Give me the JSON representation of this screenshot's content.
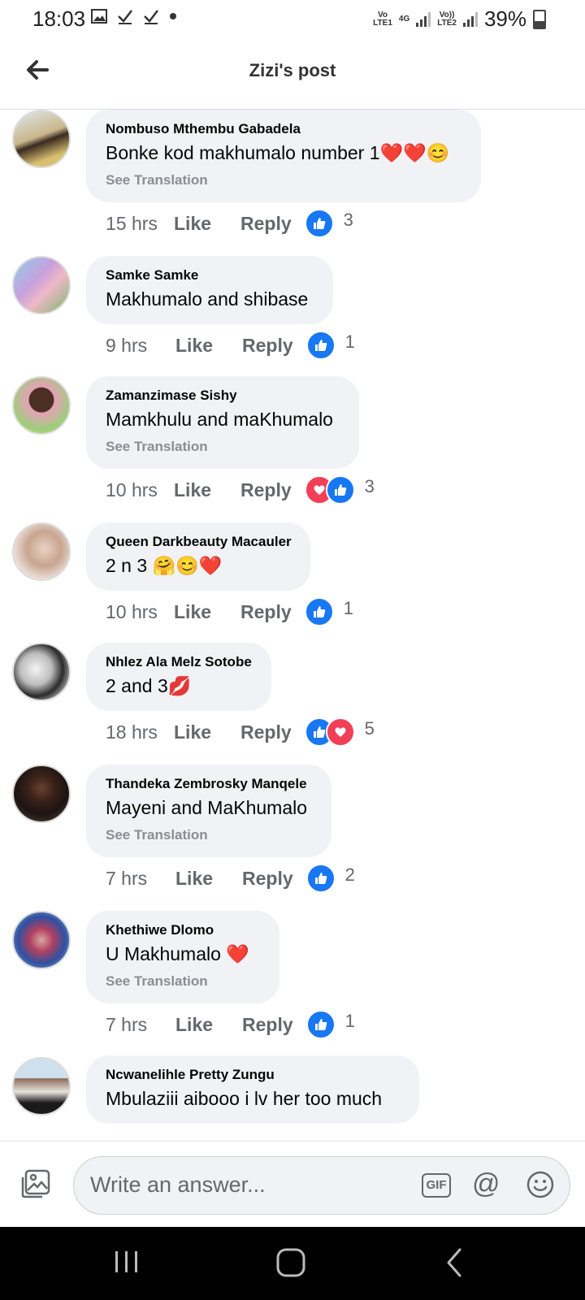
{
  "status": {
    "time": "18:03",
    "net1": "Vo LTE1",
    "net1a": "Vo",
    "net1b": "LTE1",
    "net2": "4G",
    "net3a": "Vo))",
    "net3b": "LTE2",
    "battery": "39%"
  },
  "header": {
    "title": "Zizi's post"
  },
  "actions": {
    "like": "Like",
    "reply": "Reply",
    "see_translation": "See Translation"
  },
  "comments": [
    {
      "author": "Nombuso Mthembu Gabadela",
      "text": "Bonke kod makhumalo number 1",
      "emoji": "❤️❤️😊",
      "translate": true,
      "time": "15 hrs",
      "reactions": [
        "like"
      ],
      "count": "3"
    },
    {
      "author": "Samke Samke",
      "text": "Makhumalo and shibase",
      "emoji": "",
      "translate": false,
      "time": "9 hrs",
      "reactions": [
        "like"
      ],
      "count": "1"
    },
    {
      "author": "Zamanzimase Sishy",
      "text": "Mamkhulu and maKhumalo",
      "emoji": "",
      "translate": true,
      "time": "10 hrs",
      "reactions": [
        "love",
        "like"
      ],
      "count": "3"
    },
    {
      "author": "Queen Darkbeauty Macauler",
      "text": "2 n 3 ",
      "emoji": "🤗😊❤️",
      "translate": false,
      "time": "10 hrs",
      "reactions": [
        "like"
      ],
      "count": "1"
    },
    {
      "author": "Nhlez Ala Melz Sotobe",
      "text": "2 and 3",
      "emoji": "💋",
      "translate": false,
      "time": "18 hrs",
      "reactions": [
        "like",
        "love"
      ],
      "count": "5"
    },
    {
      "author": "Thandeka Zembrosky Manqele",
      "text": "Mayeni and MaKhumalo",
      "emoji": "",
      "translate": true,
      "time": "7 hrs",
      "reactions": [
        "like"
      ],
      "count": "2"
    },
    {
      "author": "Khethiwe Dlomo",
      "text": "U Makhumalo  ",
      "emoji": "❤️",
      "translate": true,
      "time": "7 hrs",
      "reactions": [
        "like"
      ],
      "count": "1"
    },
    {
      "author": "Ncwanelihle Pretty Zungu",
      "text": "Mbulaziii aibooo i lv her too much",
      "emoji": "",
      "translate": false,
      "time": "",
      "reactions": [],
      "count": ""
    }
  ],
  "composer": {
    "placeholder": "Write an answer...",
    "gif": "GIF",
    "at": "@"
  },
  "colors": {
    "like_blue": "#1877f2",
    "love_red": "#f33e58",
    "bubble": "#f0f2f5",
    "meta_gray": "#65676b"
  }
}
